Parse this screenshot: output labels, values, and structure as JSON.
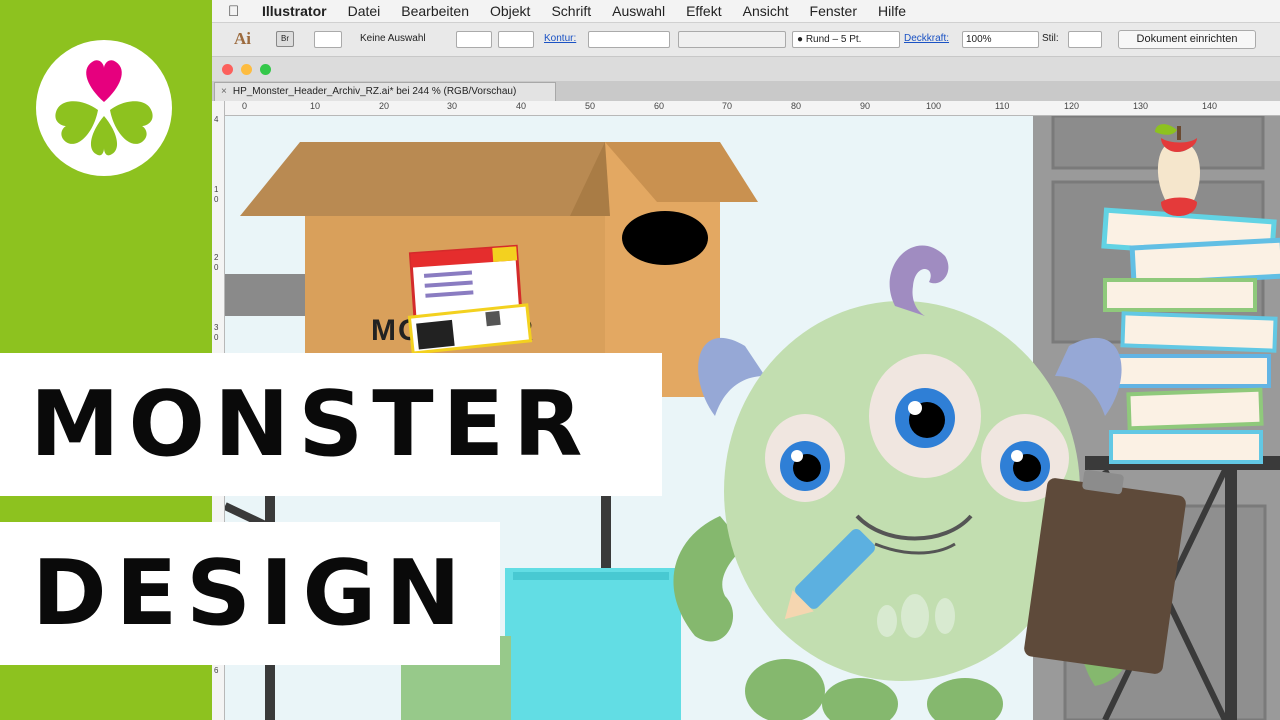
{
  "menubar": {
    "app_name": "Illustrator",
    "items": [
      "Datei",
      "Bearbeiten",
      "Objekt",
      "Schrift",
      "Auswahl",
      "Effekt",
      "Ansicht",
      "Fenster",
      "Hilfe"
    ]
  },
  "control_bar": {
    "app_abbrev": "Ai",
    "bridge_label": "Br",
    "selection_label": "Keine Auswahl",
    "stroke_label": "Kontur:",
    "brush_value": "Rund – 5 Pt.",
    "opacity_label": "Deckkraft:",
    "opacity_value": "100%",
    "style_label": "Stil:",
    "document_setup_button": "Dokument einrichten"
  },
  "document": {
    "tab_title": "HP_Monster_Header_Archiv_RZ.ai* bei 244 % (RGB/Vorschau)",
    "close_glyph": "×"
  },
  "rulers": {
    "h_ticks": [
      "0",
      "10",
      "20",
      "30",
      "40",
      "50",
      "60",
      "70",
      "80",
      "90",
      "100",
      "110",
      "120",
      "130",
      "140"
    ],
    "v_ticks": [
      "4",
      "1",
      "0",
      "2",
      "0",
      "3",
      "0",
      "4",
      "0",
      "5",
      "0",
      "6"
    ]
  },
  "artwork": {
    "box_text": "MONSTER",
    "colors": {
      "box": "#d9a05b",
      "monster_body": "#c2deb0",
      "monster_dark": "#85b86e",
      "horn": "#96a8d6",
      "tuft": "#a08cc1",
      "iris": "#2f7fd6",
      "folder": "#62dde4",
      "clipboard": "#5e4a3a"
    }
  },
  "overlay": {
    "title_line_1": "MONSTER",
    "title_line_2": "DESIGN"
  },
  "branding": {
    "logo_colors": {
      "heart": "#e6007e",
      "leaf": "#8dc21f"
    }
  }
}
